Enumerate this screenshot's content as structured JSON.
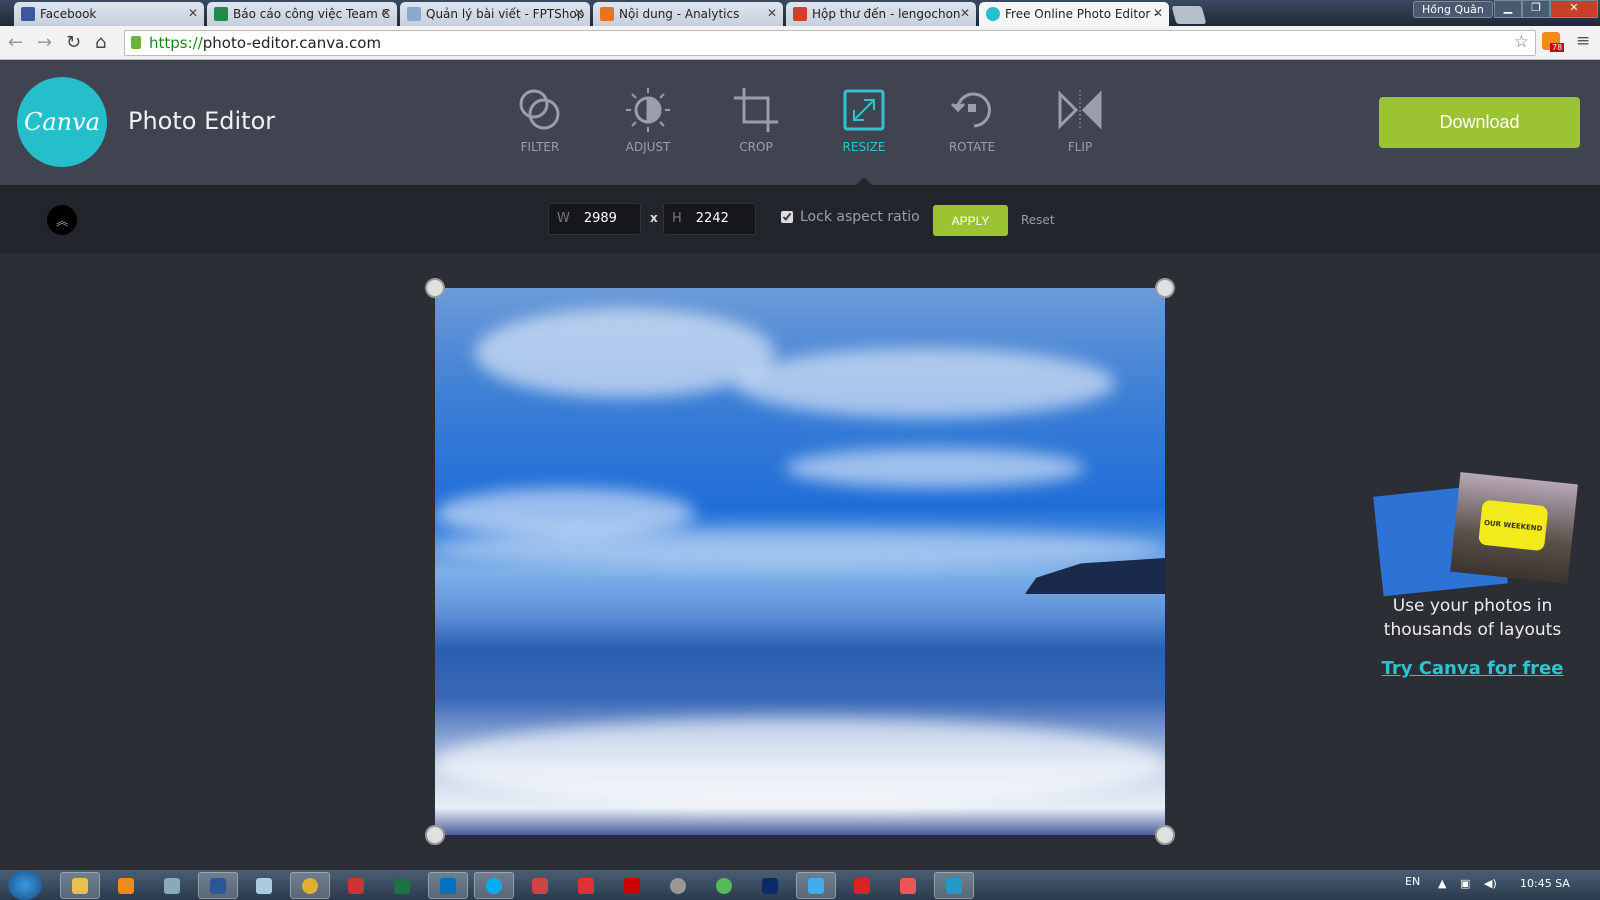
{
  "browser": {
    "tabs": [
      {
        "title": "Facebook",
        "color": "#3b5998"
      },
      {
        "title": "Báo cáo công việc Team C",
        "color": "#1e8a4c"
      },
      {
        "title": "Quản lý bài viết - FPTShop",
        "color": "#8aa8d0"
      },
      {
        "title": "Nội dung - Analytics",
        "color": "#e8741e"
      },
      {
        "title": "Hộp thư đến - lengochon",
        "color": "#d23f31"
      },
      {
        "title": "Free Online Photo Editor -",
        "color": "#25bfcb"
      }
    ],
    "user": "Hồng Quân",
    "url_scheme": "https://",
    "url_rest": "photo-editor.canva.com",
    "rss_badge": "78"
  },
  "header": {
    "logo": "Canva",
    "title": "Photo Editor",
    "download": "Download"
  },
  "tools": [
    {
      "label": "FILTER",
      "icon": "filter-icon"
    },
    {
      "label": "ADJUST",
      "icon": "adjust-icon"
    },
    {
      "label": "CROP",
      "icon": "crop-icon"
    },
    {
      "label": "RESIZE",
      "icon": "resize-icon",
      "active": true
    },
    {
      "label": "ROTATE",
      "icon": "rotate-icon"
    },
    {
      "label": "FLIP",
      "icon": "flip-icon"
    }
  ],
  "resize": {
    "w_label": "W",
    "w": "2989",
    "times": "x",
    "h_label": "H",
    "h": "2242",
    "lock_label": "Lock aspect ratio",
    "lock_checked": true,
    "apply": "APPLY",
    "reset": "Reset"
  },
  "promo": {
    "card_text": "OUR WEEKEND",
    "line1": "Use your photos in",
    "line2": "thousands of layouts",
    "link": "Try Canva for free"
  },
  "taskbar": {
    "lang": "EN",
    "time": "10:45 SA"
  },
  "colors": {
    "accent": "#2ec3cf",
    "green": "#9bc332",
    "header": "#3f4450"
  }
}
